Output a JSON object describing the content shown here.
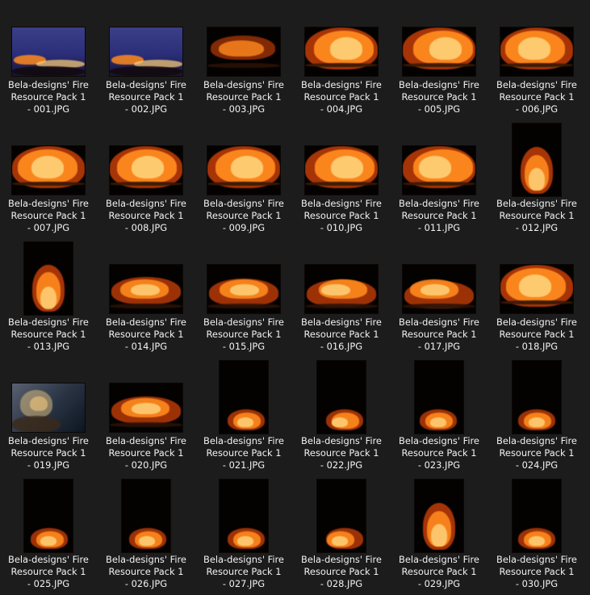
{
  "files": [
    {
      "name": "Bela-designs' Fire Resource Pack 1 - 001.JPG",
      "orientation": "landscape",
      "style": "blue-dusk"
    },
    {
      "name": "Bela-designs' Fire Resource Pack 1 - 002.JPG",
      "orientation": "landscape",
      "style": "blue-dusk"
    },
    {
      "name": "Bela-designs' Fire Resource Pack 1 - 003.JPG",
      "orientation": "landscape",
      "style": "low-fire"
    },
    {
      "name": "Bela-designs' Fire Resource Pack 1 - 004.JPG",
      "orientation": "landscape",
      "style": "wide-fire"
    },
    {
      "name": "Bela-designs' Fire Resource Pack 1 - 005.JPG",
      "orientation": "landscape",
      "style": "wide-fire"
    },
    {
      "name": "Bela-designs' Fire Resource Pack 1 - 006.JPG",
      "orientation": "landscape",
      "style": "wide-fire"
    },
    {
      "name": "Bela-designs' Fire Resource Pack 1 - 007.JPG",
      "orientation": "landscape",
      "style": "wide-fire"
    },
    {
      "name": "Bela-designs' Fire Resource Pack 1 - 008.JPG",
      "orientation": "landscape",
      "style": "wide-fire"
    },
    {
      "name": "Bela-designs' Fire Resource Pack 1 - 009.JPG",
      "orientation": "landscape",
      "style": "wide-fire"
    },
    {
      "name": "Bela-designs' Fire Resource Pack 1 - 010.JPG",
      "orientation": "landscape",
      "style": "wide-fire"
    },
    {
      "name": "Bela-designs' Fire Resource Pack 1 - 011.JPG",
      "orientation": "landscape",
      "style": "wide-fire"
    },
    {
      "name": "Bela-designs' Fire Resource Pack 1 - 012.JPG",
      "orientation": "portrait",
      "style": "tall-fire"
    },
    {
      "name": "Bela-designs' Fire Resource Pack 1 - 013.JPG",
      "orientation": "portrait",
      "style": "tall-fire"
    },
    {
      "name": "Bela-designs' Fire Resource Pack 1 - 014.JPG",
      "orientation": "landscape",
      "style": "burst"
    },
    {
      "name": "Bela-designs' Fire Resource Pack 1 - 015.JPG",
      "orientation": "landscape",
      "style": "burst"
    },
    {
      "name": "Bela-designs' Fire Resource Pack 1 - 016.JPG",
      "orientation": "landscape",
      "style": "burst"
    },
    {
      "name": "Bela-designs' Fire Resource Pack 1 - 017.JPG",
      "orientation": "landscape",
      "style": "burst"
    },
    {
      "name": "Bela-designs' Fire Resource Pack 1 - 018.JPG",
      "orientation": "landscape",
      "style": "wide-fire"
    },
    {
      "name": "Bela-designs' Fire Resource Pack 1 - 019.JPG",
      "orientation": "landscape",
      "style": "smoke"
    },
    {
      "name": "Bela-designs' Fire Resource Pack 1 - 020.JPG",
      "orientation": "landscape",
      "style": "burst"
    },
    {
      "name": "Bela-designs' Fire Resource Pack 1 - 021.JPG",
      "orientation": "portrait",
      "style": "small-fire"
    },
    {
      "name": "Bela-designs' Fire Resource Pack 1 - 022.JPG",
      "orientation": "portrait",
      "style": "small-fire"
    },
    {
      "name": "Bela-designs' Fire Resource Pack 1 - 023.JPG",
      "orientation": "portrait",
      "style": "small-fire"
    },
    {
      "name": "Bela-designs' Fire Resource Pack 1 - 024.JPG",
      "orientation": "portrait",
      "style": "small-fire"
    },
    {
      "name": "Bela-designs' Fire Resource Pack 1 - 025.JPG",
      "orientation": "portrait",
      "style": "small-fire"
    },
    {
      "name": "Bela-designs' Fire Resource Pack 1 - 026.JPG",
      "orientation": "portrait",
      "style": "small-fire"
    },
    {
      "name": "Bela-designs' Fire Resource Pack 1 - 027.JPG",
      "orientation": "portrait",
      "style": "small-fire"
    },
    {
      "name": "Bela-designs' Fire Resource Pack 1 - 028.JPG",
      "orientation": "portrait",
      "style": "small-fire"
    },
    {
      "name": "Bela-designs' Fire Resource Pack 1 - 029.JPG",
      "orientation": "portrait",
      "style": "tall-fire"
    },
    {
      "name": "Bela-designs' Fire Resource Pack 1 - 030.JPG",
      "orientation": "portrait",
      "style": "small-fire"
    }
  ],
  "colors": {
    "background": "#1c1c1c",
    "label": "#f2f2f2",
    "flame_core": "#ffd27a",
    "flame_mid": "#ff8a1e",
    "flame_edge": "#b83a08",
    "dusk": "#2b2f7a"
  }
}
